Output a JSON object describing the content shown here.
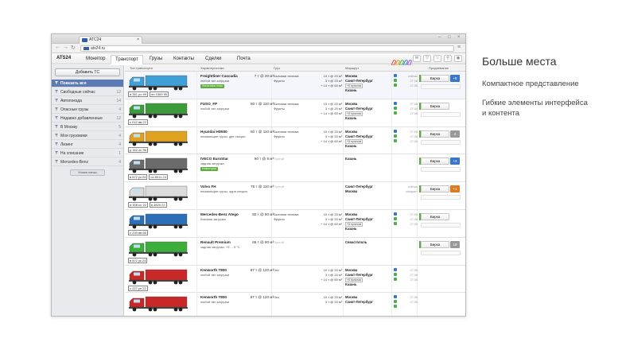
{
  "browser": {
    "tab_title": "ATC24",
    "url": "ats24.ru"
  },
  "app": {
    "logo": "ATS24",
    "nav": [
      {
        "label": "Монитор"
      },
      {
        "label": "Транспорт",
        "active": true
      },
      {
        "label": "Грузы"
      },
      {
        "label": "Контакты"
      },
      {
        "label": "Сделки"
      },
      {
        "label": "Почта"
      }
    ]
  },
  "sidebar": {
    "add_button": "Добавить ТС",
    "items": [
      {
        "label": "Показать все",
        "active": true
      },
      {
        "label": "Свободные сейчас",
        "count": "12"
      },
      {
        "label": "Автопоезда",
        "count": "14"
      },
      {
        "label": "Опасные грузы",
        "count": "4"
      },
      {
        "label": "Недавно добавленные",
        "count": "12"
      },
      {
        "label": "В Москву",
        "count": "5"
      },
      {
        "label": "Мои грузовики",
        "count": "4"
      },
      {
        "label": "Лизинг",
        "count": "4"
      },
      {
        "label": "На списание",
        "count": "1"
      },
      {
        "label": "Mercedes-Benz",
        "count": "4"
      }
    ],
    "new_folder": "Новая папка"
  },
  "table": {
    "headers": {
      "type": "Тип транспорта",
      "specs": "Характеристики",
      "cargo": "Груз",
      "route": "Маршрут",
      "extend": "Продлевание"
    },
    "rows": [
      {
        "name": "Freightliner Cascadia",
        "sub": "любой тип загрузки",
        "spec": "7 т @ 20 м³",
        "badge": "Логистика плюс",
        "cargo": "Бытовая техника\nФрукты",
        "cargo_spec": "10 т @ 20 м³\n3 т @ 20 м³\n+ 14 т @ 60 м³",
        "route": "Москва\nСанкт-Петербург\n+5 пунктов\nКазань",
        "status": "сейчас\n27.06\n27.06",
        "plates": [
          "а 351 ро 99",
          "ен 1569 55"
        ],
        "btn": "Вирка",
        "num": "+8",
        "numcolor": "#3a76c8",
        "color": "#3fa0d8"
      },
      {
        "name": "FUSO_FP",
        "sub": "любой тип загрузки",
        "spec": "50 т @ 110 м³",
        "cargo": "Бытовая техника\nФрукты",
        "cargo_spec": "10 т @ 20 м³\n3 т @ 20 м³\n+ 14 т @ 60 м³",
        "route": "Москва\nСанкт-Петербург\n+5 пунктов\nКазань",
        "status": "27.06\n27.06\n27.06",
        "plates": [
          "с 012 ав 22"
        ],
        "btn": "Вирка",
        "num": "",
        "numcolor": "",
        "color": "#3c9b3a"
      },
      {
        "name": "Hyundai HD500",
        "sub": "ппывающие грузы, две секции",
        "spec": "50 т @ 110 м³",
        "cargo": "Бытовая техника\nФрукты",
        "cargo_spec": "10 т @ 20 м³\n3 т @ 20 м³\n+ 14 т @ 60 м³",
        "route": "Москва\nСанкт-Петербург\n+5 пунктов\nКазань",
        "status": "27.06\n27.06\n27.06",
        "plates": [
          "р 342 ос 96"
        ],
        "btn": "Вирка",
        "num": "4",
        "numcolor": "#999",
        "color": "#e0a020"
      },
      {
        "name": "IVECO EuroStar",
        "sub": "задняя загрузка",
        "spec": "90 т @ 8 м³",
        "badge": "Новострои",
        "cargo": "Пустой",
        "cargo_spec": "",
        "route": "Казань",
        "status": "",
        "plates": [
          "в 872 ук 24",
          "ос 8011 24"
        ],
        "btn": "Вирка",
        "num": "+2",
        "numcolor": "#3a76c8",
        "color": "#6b6b6b",
        "empty": true
      },
      {
        "name": "Volvo FH",
        "sub": "ппывающие грузы, одна секция",
        "spec": "78 т @ 110 м³",
        "cargo": "Пустой",
        "cargo_spec": "",
        "route": "Санкт-Петербург\nМосква",
        "status": "сейчас\nожидает",
        "plates": [
          "а 308 ос 22",
          "в 3820 22"
        ],
        "btn": "Вирка",
        "num": "+1",
        "numcolor": "#e07a20",
        "color": "#dcdcdc",
        "empty": true
      },
      {
        "name": "Mercedes-Benz Atego",
        "sub": "боковая загрузка",
        "spec": "60 т @ 90 м³",
        "cargo": "Бытовая техника\nФрукты",
        "cargo_spec": "10 т @ 20 м³\n3 т @ 20 м³\n+ 14 т @ 60 м³",
        "route": "Москва\nСанкт-Петербург\n+5 пунктов\nКазань",
        "status": "27.06\n27.06\n27.06",
        "plates": [
          "с 239 ав 66"
        ],
        "btn": "Вирка",
        "num": "",
        "numcolor": "",
        "color": "#2a6fb8"
      },
      {
        "name": "Renault Premium",
        "sub": "задняя загрузка, +5 ... 5 °C",
        "spec": "65 т @ 90 м³",
        "cargo": "Пустой",
        "cargo_spec": "",
        "route": "Севастополь",
        "status": "",
        "plates": [
          "в 872 ук 24"
        ],
        "btn": "Вирка",
        "num": "19",
        "numcolor": "#999",
        "color": "#3cae3c",
        "empty": true
      },
      {
        "name": "Kenworth T800",
        "sub": "любой тип загрузки",
        "spec": "87 т @ 120 м³",
        "cargo": "Лес",
        "cargo_spec": "10 т @ 20 м³\n3 т @ 20 м³\n+ 14 т @ 60 м³",
        "route": "Москва\nСанкт-Петербург\n+5 пунктов\nКазань",
        "status": "27.06\n27.06\n27.06",
        "plates": [
          "с 227 ун 22"
        ],
        "btn": "",
        "num": "",
        "numcolor": "",
        "color": "#c82828"
      },
      {
        "name": "Kenworth T800",
        "sub": "любой тип загрузки",
        "spec": "87 т @ 120 м³",
        "cargo": "Лес",
        "cargo_spec": "10 т @ 20 м³\n3 т @ 20 м³",
        "route": "Москва\nСанкт-Петербург",
        "status": "27.06\n27.06",
        "plates": [],
        "btn": "",
        "num": "",
        "numcolor": "",
        "color": "#c82828"
      }
    ]
  },
  "promo": {
    "title": "Больше места",
    "line1": "Компактное представление",
    "line2a": "Гибкие элементы интерфейса",
    "line2b": "и контента"
  }
}
